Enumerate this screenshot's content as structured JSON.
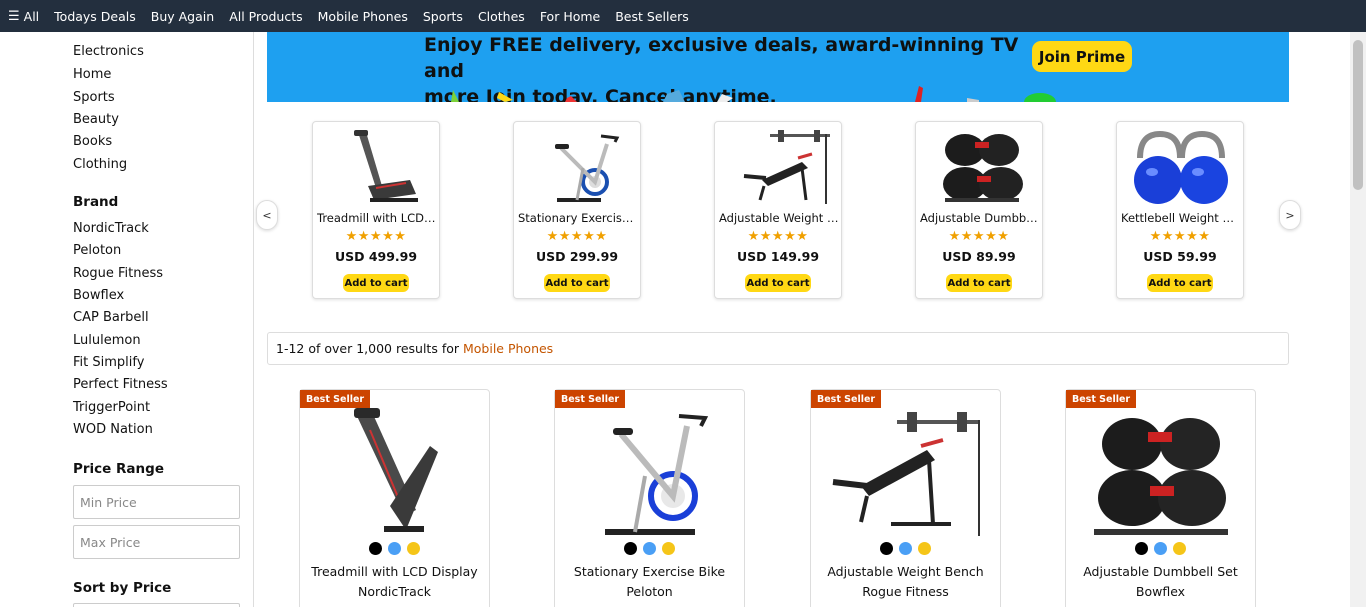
{
  "topnav": {
    "all_label": "All",
    "items": [
      "Todays Deals",
      "Buy Again",
      "All Products",
      "Mobile Phones",
      "Sports",
      "Clothes",
      "For Home",
      "Best Sellers"
    ]
  },
  "sidebar": {
    "categories": [
      "Electronics",
      "Home",
      "Sports",
      "Beauty",
      "Books",
      "Clothing"
    ],
    "brand_heading": "Brand",
    "brands": [
      "NordicTrack",
      "Peloton",
      "Rogue Fitness",
      "Bowflex",
      "CAP Barbell",
      "Lululemon",
      "Fit Simplify",
      "Perfect Fitness",
      "TriggerPoint",
      "WOD Nation"
    ],
    "price_heading": "Price Range",
    "min_placeholder": "Min Price",
    "max_placeholder": "Max Price",
    "sort_heading": "Sort by Price"
  },
  "banner": {
    "line1": "Enjoy FREE delivery, exclusive deals, award-winning TV and",
    "line2": "more Join today. Cancel anytime.",
    "button": "Join Prime"
  },
  "carousel": {
    "prev": "<",
    "next": ">",
    "items": [
      {
        "title": "Treadmill with LCD Display",
        "stars": "★★★★★",
        "rating": 5,
        "price": "USD 499.99",
        "add": "Add to cart",
        "icon": "treadmill"
      },
      {
        "title": "Stationary Exercise Bike",
        "stars": "★★★★★",
        "rating": 5,
        "price": "USD 299.99",
        "add": "Add to cart",
        "icon": "exercise-bike"
      },
      {
        "title": "Adjustable Weight Bench",
        "stars": "★★★★★",
        "rating": 5,
        "price": "USD 149.99",
        "add": "Add to cart",
        "icon": "weight-bench"
      },
      {
        "title": "Adjustable Dumbbell Set",
        "stars": "★★★★★",
        "rating": 5,
        "price": "USD 89.99",
        "add": "Add to cart",
        "icon": "dumbbells"
      },
      {
        "title": "Kettlebell Weight Set",
        "stars": "★★★★★",
        "rating": 5,
        "price": "USD 59.99",
        "add": "Add to cart",
        "icon": "kettlebells"
      }
    ]
  },
  "results": {
    "prefix": "1-12 of over 1,000 results for ",
    "query": "Mobile Phones"
  },
  "products": [
    {
      "badge": "Best Seller",
      "title": "Treadmill with LCD Display",
      "brand": "NordicTrack",
      "icon": "treadmill"
    },
    {
      "badge": "Best Seller",
      "title": "Stationary Exercise Bike",
      "brand": "Peloton",
      "icon": "exercise-bike"
    },
    {
      "badge": "Best Seller",
      "title": "Adjustable Weight Bench",
      "brand": "Rogue Fitness",
      "icon": "weight-bench"
    },
    {
      "badge": "Best Seller",
      "title": "Adjustable Dumbbell Set",
      "brand": "Bowflex",
      "icon": "dumbbells"
    }
  ],
  "swatch_colors": [
    "#000000",
    "#4a9ff5",
    "#f5c518"
  ],
  "colors": {
    "nav_bg": "#232f3e",
    "banner_bg": "#1ea0f0",
    "prime_button": "#ffd814",
    "badge": "#cc4400",
    "query": "#c45500",
    "stars": "#f0a000"
  }
}
